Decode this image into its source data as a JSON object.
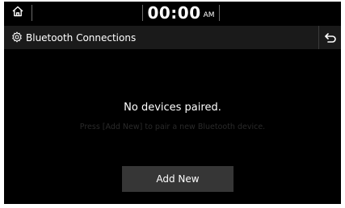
{
  "status_bar": {
    "home_icon": "home-icon",
    "time": "00:00",
    "ampm": "AM"
  },
  "header": {
    "settings_icon": "settings-gear-icon",
    "title": "Bluetooth Connections",
    "back_icon": "back-arrow-icon"
  },
  "main": {
    "message": "No devices paired.",
    "hint": "Press [Add New] to pair a new Bluetooth device.",
    "add_new_label": "Add New"
  },
  "colors": {
    "screen_background": "#000000",
    "title_bar": "#1a1a1a",
    "button": "#363636",
    "text": "#ffffff"
  }
}
